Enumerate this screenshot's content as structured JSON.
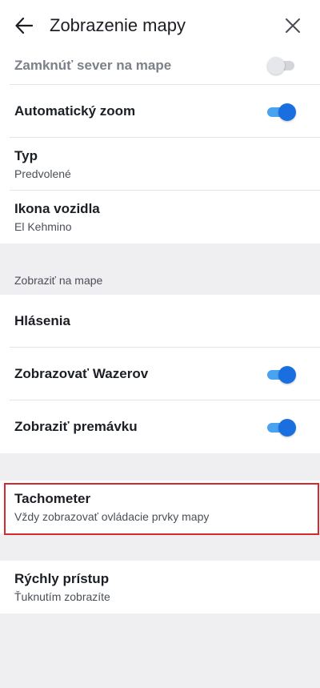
{
  "header": {
    "title": "Zobrazenie mapy",
    "back_icon": "arrow-left-icon",
    "close_icon": "close-icon"
  },
  "settings": {
    "north_lock": {
      "label": "Zamknúť sever na mape",
      "enabled": false
    },
    "auto_zoom": {
      "label": "Automatický zoom",
      "enabled": true
    },
    "type": {
      "label": "Typ",
      "value": "Predvolené"
    },
    "vehicle_icon": {
      "label": "Ikona vozidla",
      "value": "El Kehmino"
    }
  },
  "show_on_map": {
    "section_title": "Zobraziť na mape",
    "reports": {
      "label": "Hlásenia"
    },
    "show_wazers": {
      "label": "Zobrazovať Wazerov",
      "enabled": true
    },
    "show_traffic": {
      "label": "Zobraziť premávku",
      "enabled": true
    }
  },
  "speedometer": {
    "label": "Tachometer",
    "value": "Vždy zobrazovať ovládacie prvky mapy"
  },
  "quick_access": {
    "label": "Rýchly prístup",
    "value": "Ťuknutím zobrazíte"
  },
  "colors": {
    "toggle_on_knob": "#1a6fe0",
    "toggle_on_track": "#4aa3f0",
    "highlight": "#d8282f"
  }
}
